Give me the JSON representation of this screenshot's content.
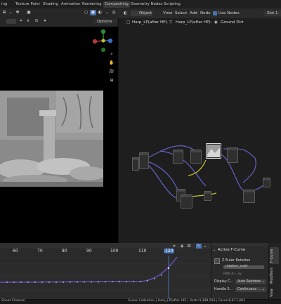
{
  "topbar": {
    "tabs": [
      "ing",
      "Texture Paint",
      "Shading",
      "Animation",
      "Rendering",
      "Compositing",
      "Geometry Nodes",
      "Scripting"
    ]
  },
  "viewport": {
    "options_label": "Options"
  },
  "node_editor": {
    "menu": [
      "Object",
      "View",
      "Select",
      "Add",
      "Node"
    ],
    "use_nodes_label": "Use Nodes",
    "slot_label": "Slot 1",
    "breadcrumb": [
      "Harp_LP(after HP)",
      "Harp_LP(after HP)",
      "Ground Dirt"
    ]
  },
  "graph_editor": {
    "ruler": [
      "60",
      "70",
      "80",
      "90",
      "100",
      "110",
      "120"
    ],
    "current_frame": "120"
  },
  "side_panel": {
    "title": "Active F-Curve",
    "channel": "Z Euler Rotation",
    "data_path": "rotation_euler",
    "rna_array_label": "RNA Ar...ay",
    "display_color_label": "Display C...",
    "display_color_value": "Auto Rainbow",
    "handle_label": "Handle S...",
    "handle_value": "Continuous ...",
    "tabs": [
      "F-Curve",
      "Modifiers",
      "View"
    ]
  },
  "status_bar": {
    "left": "Sheet Channel",
    "right": "Scene Collection | Harp_LP(after HP) | Verts:4,398,593 | Faces:8,677,093"
  },
  "colors": {
    "accent_blue": "#4772b3",
    "wire_purple": "#6363c7",
    "wire_yellow": "#c7c729",
    "curve_white": "#e0e0e0"
  }
}
